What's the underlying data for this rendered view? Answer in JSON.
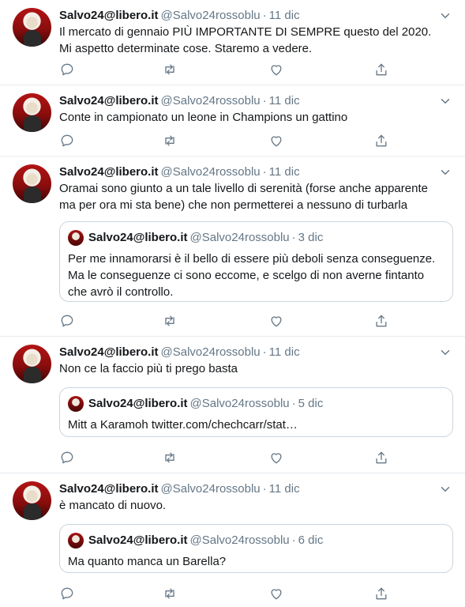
{
  "tweets": [
    {
      "name": "Salvo24@libero.it",
      "handle": "@Salvo24rossoblu",
      "dot": "·",
      "time": "11 dic",
      "text": "Il mercato di gennaio PIÙ IMPORTANTE DI SEMPRE questo del 2020. Mi aspetto determinate cose. Staremo a vedere."
    },
    {
      "name": "Salvo24@libero.it",
      "handle": "@Salvo24rossoblu",
      "dot": "·",
      "time": "11 dic",
      "text": "Conte in campionato un leone in Champions un gattino"
    },
    {
      "name": "Salvo24@libero.it",
      "handle": "@Salvo24rossoblu",
      "dot": "·",
      "time": "11 dic",
      "text": "Oramai sono giunto a un tale livello di serenità (forse anche apparente ma per ora mi sta bene) che non permetterei a nessuno di turbarla",
      "quote": {
        "name": "Salvo24@libero.it",
        "handle": "@Salvo24rossoblu",
        "dot": "·",
        "time": "3 dic",
        "text": "Per me innamorarsi è il bello di essere più deboli senza conseguenze. Ma le conseguenze ci sono eccome, e scelgo di non averne fintanto che avrò il controllo."
      }
    },
    {
      "name": "Salvo24@libero.it",
      "handle": "@Salvo24rossoblu",
      "dot": "·",
      "time": "11 dic",
      "text": "Non ce la faccio più ti prego basta",
      "quote": {
        "name": "Salvo24@libero.it",
        "handle": "@Salvo24rossoblu",
        "dot": "·",
        "time": "5 dic",
        "text": "Mitt a Karamoh twitter.com/chechcarr/stat…"
      }
    },
    {
      "name": "Salvo24@libero.it",
      "handle": "@Salvo24rossoblu",
      "dot": "·",
      "time": "11 dic",
      "text": "è mancato di nuovo.",
      "quote": {
        "name": "Salvo24@libero.it",
        "handle": "@Salvo24rossoblu",
        "dot": "·",
        "time": "6 dic",
        "text": "Ma quanto manca un Barella?"
      }
    }
  ],
  "icons": {
    "reply": "reply-icon",
    "retweet": "retweet-icon",
    "like": "heart-icon",
    "share": "share-icon",
    "caret": "chevron-down-icon"
  },
  "colors": {
    "text": "#14171a",
    "secondary": "#657786",
    "border": "#e6ecf0",
    "quote_border": "#ccd6dd"
  }
}
